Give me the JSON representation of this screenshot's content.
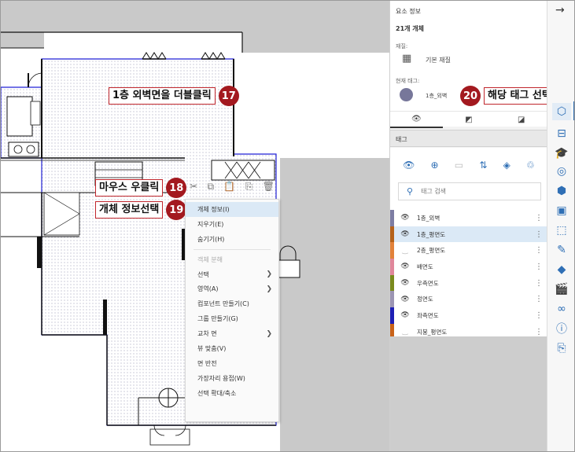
{
  "callouts": [
    {
      "text": "1층 외벽면을 더블클릭",
      "badge": "17"
    },
    {
      "text": "마우스 우클릭",
      "badge": "18"
    },
    {
      "text": "개체 정보선택",
      "badge": "19"
    },
    {
      "text": "해당 태그 선택",
      "badge": "20"
    }
  ],
  "context_toolbar": [
    "✂",
    "⧉",
    "📋",
    "⎘",
    "🗑"
  ],
  "context_menu": {
    "items": [
      {
        "label": "개체 정보(I)",
        "highlighted": true
      },
      {
        "label": "지우기(E)"
      },
      {
        "label": "숨기기(H)"
      },
      {
        "label": "객체 분해",
        "disabled": true
      },
      {
        "label": "선택",
        "submenu": true
      },
      {
        "label": "영역(A)",
        "submenu": true
      },
      {
        "label": "컴포넌트 만들기(C)"
      },
      {
        "label": "그룹 만들기(G)"
      },
      {
        "label": "교차 면",
        "submenu": true
      },
      {
        "label": "뷰 맞춤(V)"
      },
      {
        "label": "면 반전"
      },
      {
        "label": "가장자리 용접(W)"
      },
      {
        "label": "선택 확대/축소"
      }
    ]
  },
  "entity_info": {
    "title": "요소 정보",
    "count": "21개 개체",
    "material_label": "재질:",
    "material_value": "기본 재질",
    "tag_label": "현재 태그:",
    "tag_value": "1층_외벽",
    "tag_color": "#77779a",
    "tabs": [
      "eye-icon",
      "layers-icon",
      "eraser-icon"
    ]
  },
  "tags": {
    "title": "태그",
    "toolbar": [
      "eye-icon",
      "add-icon",
      "folder-icon",
      "sort-az-icon",
      "tag-paint-icon",
      "purge-icon"
    ],
    "search_placeholder": "태그 검색",
    "rows": [
      {
        "name": "1층_외벽",
        "color": "#7d7da3",
        "visible": true
      },
      {
        "name": "1층_평면도",
        "color": "#b5621b",
        "visible": true,
        "selected": true
      },
      {
        "name": "2층_평면도",
        "color": "#e2823a",
        "visible": false
      },
      {
        "name": "배면도",
        "color": "#e0879b",
        "visible": true
      },
      {
        "name": "우측면도",
        "color": "#7a8a1d",
        "visible": true
      },
      {
        "name": "정면도",
        "color": "#9c95b3",
        "visible": true
      },
      {
        "name": "좌측면도",
        "color": "#1e1fb5",
        "visible": true
      },
      {
        "name": "지붕_평면도",
        "color": "#c9631a",
        "visible": false
      }
    ]
  },
  "strip_icons": [
    "entity-info-icon",
    "components-icon",
    "instructor-icon",
    "materials-icon",
    "component-options-icon",
    "solid-tools-icon",
    "styles-icon",
    "tags-icon",
    "soften-icon",
    "scenes-icon",
    "shadows-icon",
    "info-icon",
    "export-icon"
  ]
}
